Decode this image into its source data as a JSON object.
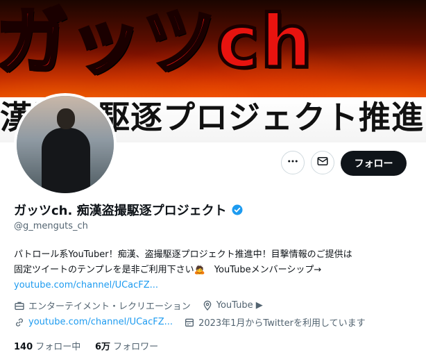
{
  "banner": {
    "title": "ガッツch",
    "subtitle": "漢盗撮駆逐プロジェクト推進"
  },
  "profile": {
    "display_name": "ガッツch. 痴漢盗撮駆逐プロジェクト",
    "handle": "@g_menguts_ch",
    "bio_line1": "パトロール系YouTuber！痴漢、盗撮駆逐プロジェクト推進中！目撃情報のご提供は",
    "bio_line2": "固定ツイートのテンプレを是非ご利用下さい🙇　YouTubeメンバーシップ→",
    "bio_link": "youtube.com/channel/UCacFZ...",
    "category": "エンターテイメント・レクリエーション",
    "location": "YouTube ▶",
    "website": "youtube.com/channel/UCacFZ...",
    "joined": "2023年1月からTwitterを利用しています",
    "following_count": "140",
    "following_label": "フォロー中",
    "followers_count": "6万",
    "followers_label": "フォロワー"
  },
  "actions": {
    "more_icon": "more-horizontal-icon",
    "message_icon": "envelope-icon",
    "follow_label": "フォロー"
  },
  "colors": {
    "accent": "#1d9bf0",
    "follow_bg": "#0f1419",
    "secondary_text": "#536471"
  }
}
